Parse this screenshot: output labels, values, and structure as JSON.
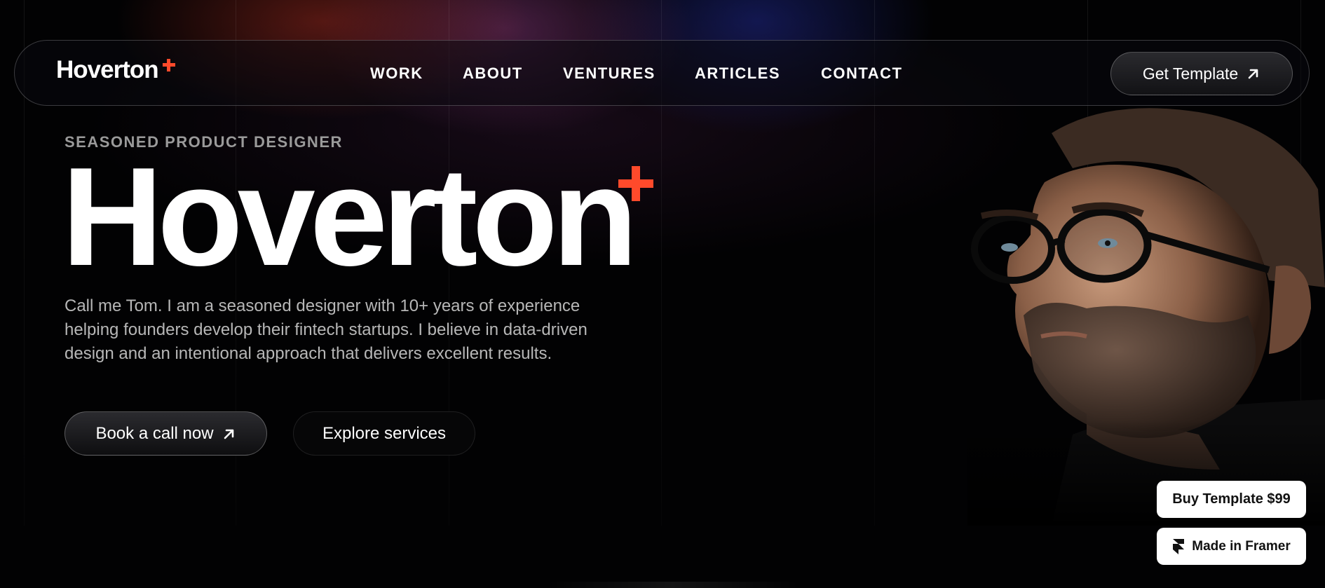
{
  "header": {
    "logo_text": "Hoverton",
    "nav": [
      {
        "label": "WORK"
      },
      {
        "label": "ABOUT"
      },
      {
        "label": "VENTURES"
      },
      {
        "label": "ARTICLES"
      },
      {
        "label": "CONTACT"
      }
    ],
    "cta_label": "Get Template"
  },
  "hero": {
    "eyebrow": "SEASONED PRODUCT DESIGNER",
    "title": "Hoverton",
    "description": "Call me Tom. I am a seasoned designer with 10+ years of experience helping founders develop their fintech startups. I believe in data-driven design and an intentional approach that delivers excellent results.",
    "primary_button": "Book a call now",
    "secondary_button": "Explore services"
  },
  "badges": {
    "buy_label": "Buy Template $99",
    "framer_label": "Made in Framer"
  },
  "colors": {
    "accent": "#ff4a2b",
    "background": "#020203",
    "text": "#ffffff",
    "muted": "#9a9a9a"
  },
  "icons": {
    "arrow": "arrow-up-right-icon",
    "framer": "framer-logo-icon"
  }
}
